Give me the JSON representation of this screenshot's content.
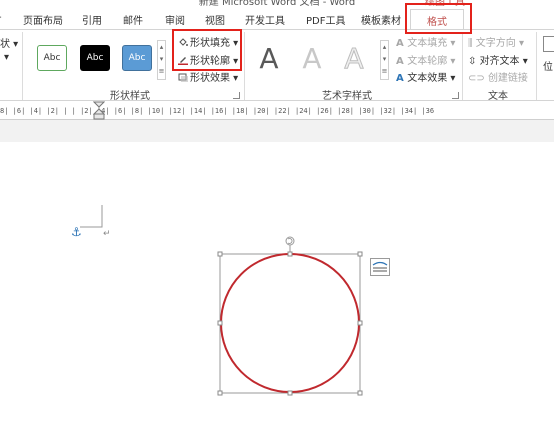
{
  "window": {
    "title": "新建 Microsoft Word 文档 - Word",
    "context_tab_group": "绘图工具"
  },
  "tabs": [
    "页面布局",
    "引用",
    "邮件",
    "审阅",
    "视图",
    "开发工具",
    "PDF工具",
    "模板素材",
    "格式"
  ],
  "ribbon": {
    "left_partial": "状",
    "shape_styles": {
      "label": "形状样式",
      "swatches": [
        "Abc",
        "Abc",
        "Abc"
      ],
      "fill": "形状填充",
      "outline": "形状轮廓",
      "effects": "形状效果"
    },
    "wordart": {
      "label": "艺术字样式",
      "letters": [
        "A",
        "A",
        "A"
      ],
      "text_fill": "文本填充",
      "text_outline": "文本轮廓",
      "text_effects": "文本效果"
    },
    "text_group": {
      "label": "文本",
      "direction": "文字方向",
      "align": "对齐文本",
      "link": "创建链接"
    },
    "position_partial": "位"
  },
  "ruler": {
    "scale": "8| |6| |4| |2| |  | |2| |4| |6| |8| |10| |12| |14| |16| |18| |20| |22| |24| |26| |28| |30| |32| |34| |36"
  },
  "colors": {
    "accent_red": "#c0504d",
    "highlight_box": "#e3221b",
    "circle_stroke": "#c0292e",
    "tab_text": "#c0504d"
  }
}
